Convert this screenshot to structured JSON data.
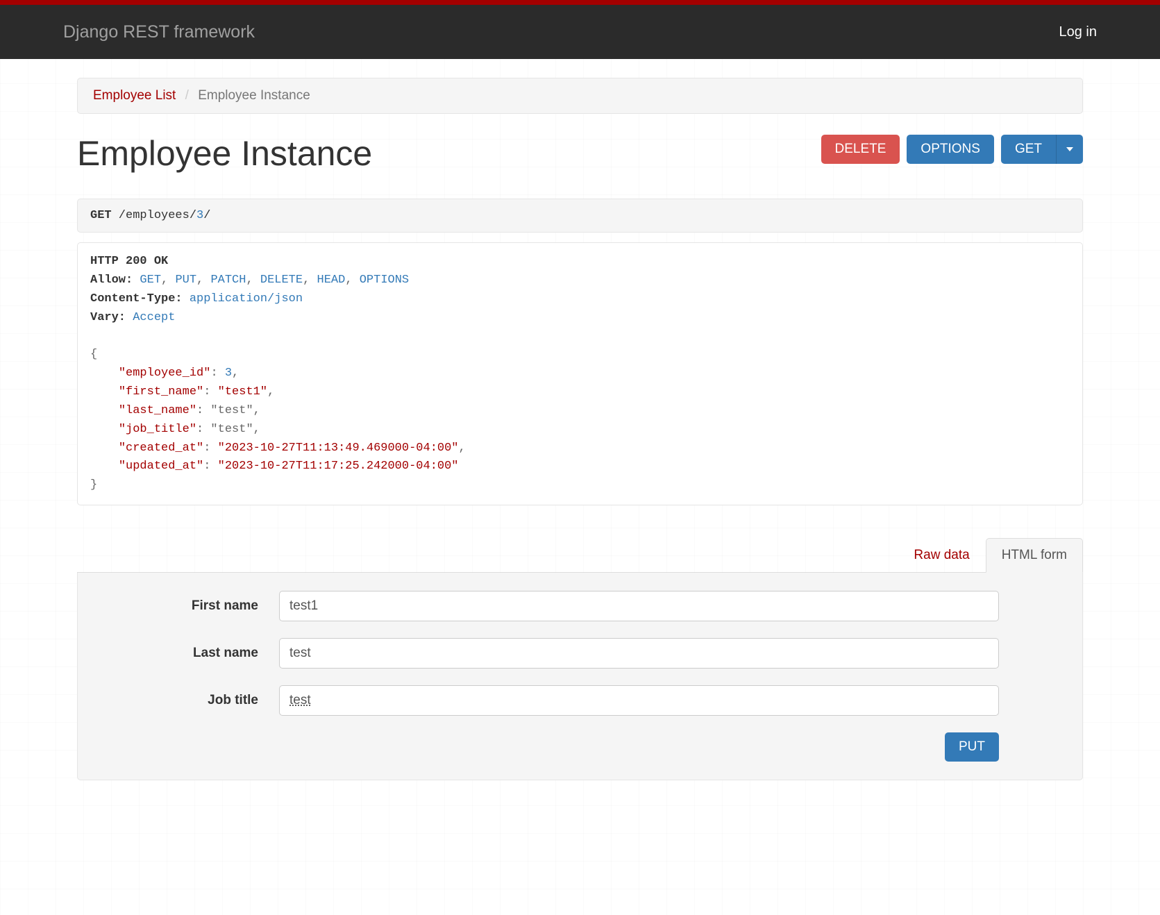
{
  "nav": {
    "brand": "Django REST framework",
    "login": "Log in"
  },
  "breadcrumb": {
    "parent": "Employee List",
    "current": "Employee Instance"
  },
  "header": {
    "title": "Employee Instance"
  },
  "buttons": {
    "delete": "DELETE",
    "options": "OPTIONS",
    "get": "GET"
  },
  "request": {
    "method": "GET",
    "path_prefix": " /employees/",
    "id": "3",
    "path_suffix": "/"
  },
  "response": {
    "status": "HTTP 200 OK",
    "headers": {
      "allow_label": "Allow:",
      "allow_values": [
        "GET",
        "PUT",
        "PATCH",
        "DELETE",
        "HEAD",
        "OPTIONS"
      ],
      "content_type_label": "Content-Type:",
      "content_type_value": "application/json",
      "vary_label": "Vary:",
      "vary_value": "Accept"
    },
    "body": {
      "employee_id": 3,
      "first_name": "test1",
      "last_name": "test",
      "job_title": "test",
      "created_at": "2023-10-27T11:13:49.469000-04:00",
      "updated_at": "2023-10-27T11:17:25.242000-04:00"
    }
  },
  "tabs": {
    "raw": "Raw data",
    "html": "HTML form"
  },
  "form": {
    "first_name": {
      "label": "First name",
      "value": "test1"
    },
    "last_name": {
      "label": "Last name",
      "value": "test"
    },
    "job_title": {
      "label": "Job title",
      "value": "test"
    },
    "submit": "PUT"
  }
}
